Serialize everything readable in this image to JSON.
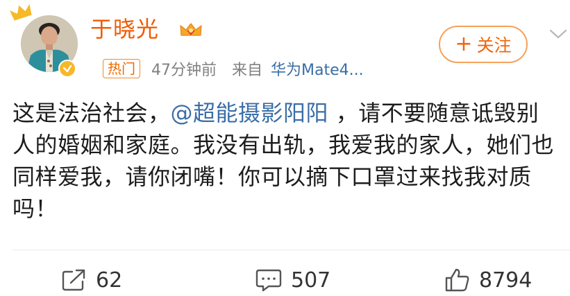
{
  "user": {
    "name": "于晓光",
    "badge": "热门",
    "time": "47分钟前",
    "source_prefix": "来自",
    "device": "华为Mate4..."
  },
  "follow_button": {
    "plus": "+",
    "label": "关注"
  },
  "post": {
    "text_before": "这是法治社会，",
    "mention": "@超能摄影阳阳",
    "text_after": " ，请不要随意诋毁别人的婚姻和家庭。我没有出轨，我爱我的家人，她们也同样爱我，请你闭嘴！你可以摘下口罩过来找我对质吗！"
  },
  "actions": {
    "share_count": "62",
    "comment_count": "507",
    "like_count": "8794"
  },
  "colors": {
    "username": "#f05a00",
    "mention": "#3b6ea8",
    "follow_border": "#f5a15a"
  },
  "icons": [
    "crown-decoration-icon",
    "verified-icon",
    "vip-crown-icon",
    "chevron-down-icon",
    "share-icon",
    "comment-icon",
    "like-icon"
  ]
}
